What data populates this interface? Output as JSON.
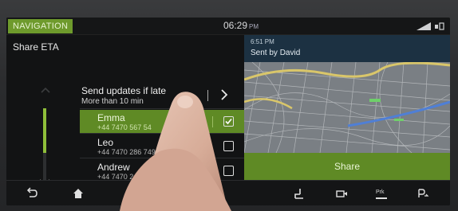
{
  "status": {
    "nav_label": "NAVIGATION",
    "time": "06:29",
    "ampm": "PM",
    "signal_icon": "signal-icon",
    "wifi_icon": "wifi-icon"
  },
  "left": {
    "title": "Share ETA",
    "updates": {
      "label": "Send updates if late",
      "value": "More than 10 min"
    },
    "contacts": [
      {
        "name": "Emma",
        "number": "+44 7470 567 54",
        "checked": true
      },
      {
        "name": "Leo",
        "number": "+44 7470 286 749",
        "checked": false
      },
      {
        "name": "Andrew",
        "number": "+44 7470 248 248",
        "checked": false
      }
    ]
  },
  "right": {
    "msg_time": "6:51 PM",
    "sent_by": "Sent by David",
    "share_label": "Share"
  },
  "bottom_bar": {
    "items": [
      {
        "icon": "back-icon"
      },
      {
        "icon": "home-icon"
      },
      {
        "icon": "seat-icon"
      },
      {
        "icon": "camera-icon"
      },
      {
        "label": "Prk",
        "icon": "park-assist-icon"
      },
      {
        "icon": "parking-exit-icon"
      }
    ]
  },
  "colors": {
    "accent_green": "#5f8a25",
    "header_blue": "#1c3142",
    "background": "#0e0f10"
  }
}
